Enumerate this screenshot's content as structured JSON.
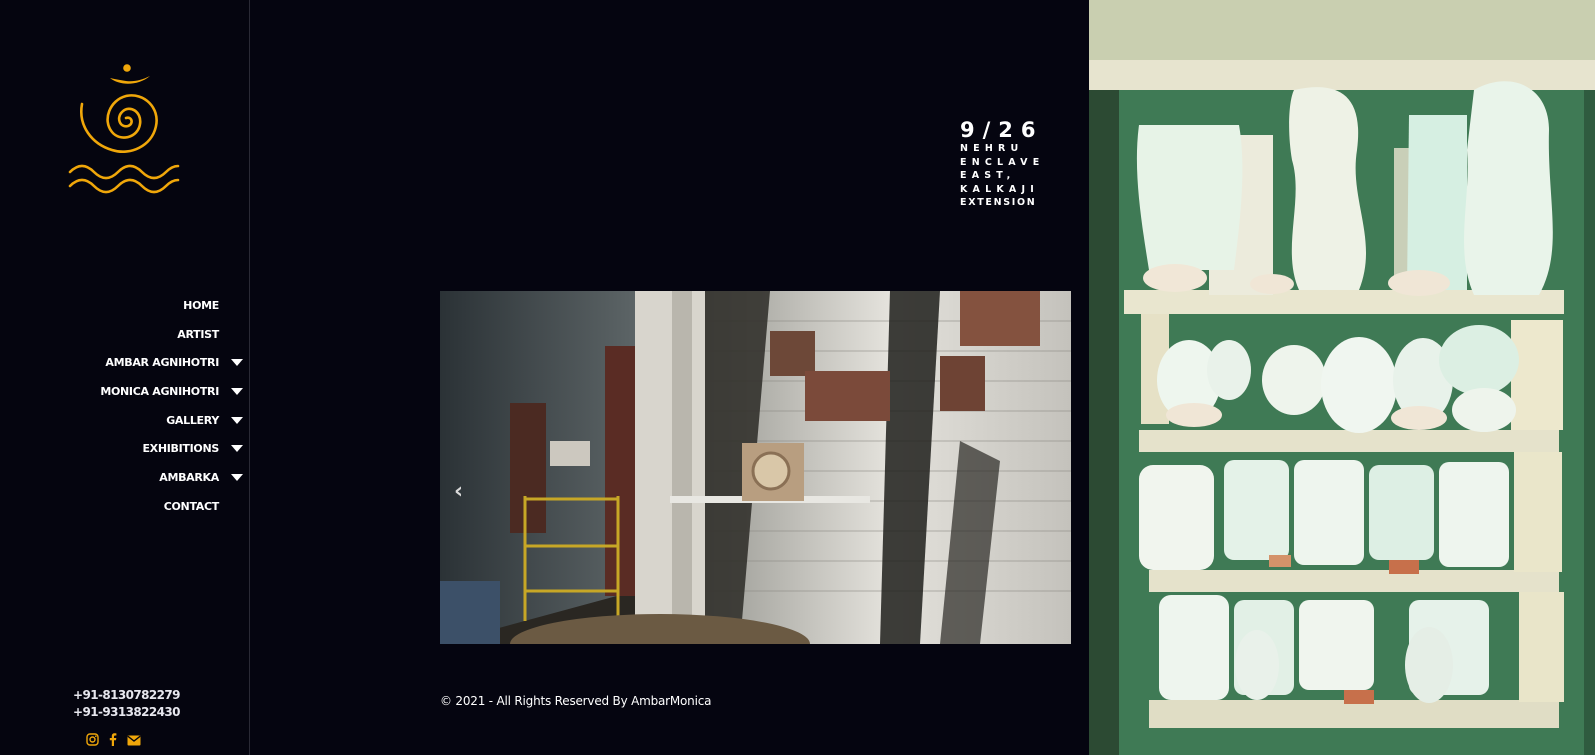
{
  "sidebar": {
    "logo_icon": "spiral-waves-logo",
    "nav": [
      {
        "label": "HOME",
        "has_dropdown": false
      },
      {
        "label": "ARTIST",
        "has_dropdown": false
      },
      {
        "label": "AMBAR AGNIHOTRI",
        "has_dropdown": true
      },
      {
        "label": "MONICA AGNIHOTRI",
        "has_dropdown": true
      },
      {
        "label": "GALLERY",
        "has_dropdown": true
      },
      {
        "label": "EXHIBITIONS",
        "has_dropdown": true
      },
      {
        "label": "AMBARKA",
        "has_dropdown": true
      },
      {
        "label": "CONTACT",
        "has_dropdown": false
      }
    ],
    "phones": [
      "+91-8130782279",
      "+91-9313822430"
    ],
    "social_icons": [
      "instagram-icon",
      "facebook-icon",
      "envelope-icon"
    ]
  },
  "address": {
    "number": "9/26",
    "lines": [
      "NEHRU",
      "ENCLAVE",
      "EAST,",
      "KALKAJI",
      "EXTENSION"
    ]
  },
  "slider": {
    "prev_icon": "chevron-left-icon",
    "prev_glyph": "‹"
  },
  "footer": {
    "copyright": "© 2021 - All Rights Reserved By AmbarMonica"
  },
  "colors": {
    "background": "#050510",
    "accent": "#f0a70a",
    "text": "#ffffff"
  }
}
